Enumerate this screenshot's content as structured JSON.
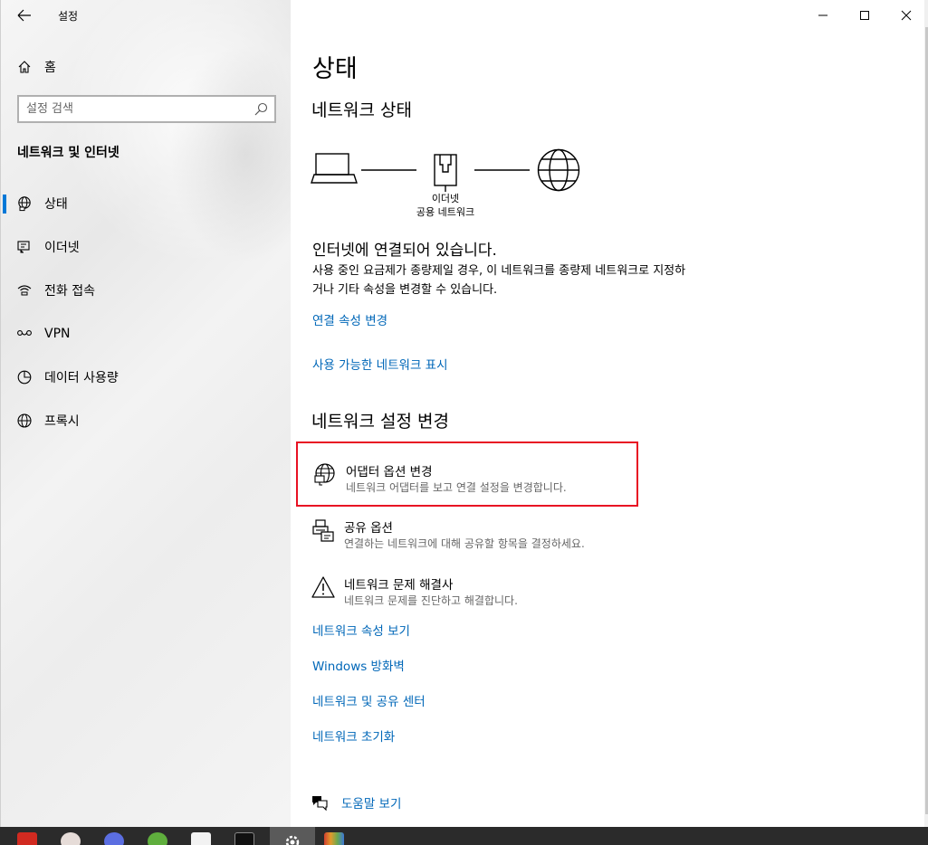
{
  "window": {
    "title": "설정"
  },
  "sidebar": {
    "home_label": "홈",
    "search_placeholder": "설정 검색",
    "section_title": "네트워크 및 인터넷",
    "items": [
      {
        "label": "상태",
        "icon": "globe-status-icon",
        "active": true
      },
      {
        "label": "이더넷",
        "icon": "ethernet-icon"
      },
      {
        "label": "전화 접속",
        "icon": "dialup-icon"
      },
      {
        "label": "VPN",
        "icon": "vpn-icon"
      },
      {
        "label": "데이터 사용량",
        "icon": "data-usage-icon"
      },
      {
        "label": "프록시",
        "icon": "globe-icon"
      }
    ]
  },
  "main": {
    "page_title": "상태",
    "network_status_heading": "네트워크 상태",
    "diagram": {
      "label_line1": "이더넷",
      "label_line2": "공용 네트워크"
    },
    "connected_text": "인터넷에 연결되어 있습니다.",
    "connected_desc": "사용 중인 요금제가 종량제일 경우, 이 네트워크를 종량제 네트워크로 지정하거나 기타 속성을 변경할 수 있습니다.",
    "links_top": [
      "연결 속성 변경",
      "사용 가능한 네트워크 표시"
    ],
    "change_settings_heading": "네트워크 설정 변경",
    "options": [
      {
        "title": "어댑터 옵션 변경",
        "desc": "네트워크 어댑터를 보고 연결 설정을 변경합니다.",
        "icon": "adapter-icon"
      },
      {
        "title": "공유 옵션",
        "desc": "연결하는 네트워크에 대해 공유할 항목을 결정하세요.",
        "icon": "sharing-icon"
      },
      {
        "title": "네트워크 문제 해결사",
        "desc": "네트워크 문제를 진단하고 해결합니다.",
        "icon": "warning-icon"
      }
    ],
    "links_bottom": [
      "네트워크 속성 보기",
      "Windows 방화벽",
      "네트워크 및 공유 센터",
      "네트워크 초기화"
    ],
    "help_label": "도움말 보기"
  },
  "colors": {
    "accent": "#0078d7",
    "link": "#0067b8",
    "highlight": "#e81123"
  }
}
